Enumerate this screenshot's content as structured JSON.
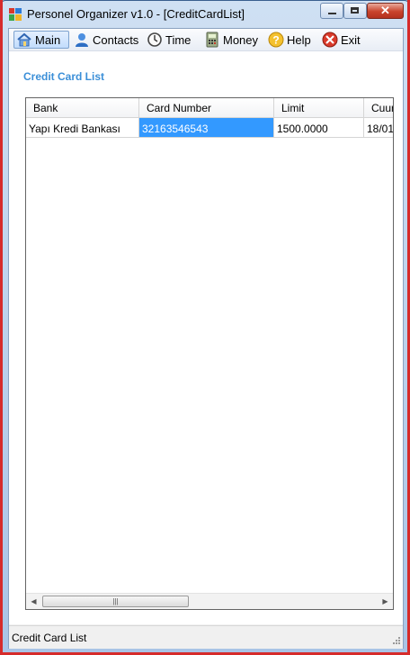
{
  "window": {
    "title": "Personel Organizer v1.0 - [CreditCardList]"
  },
  "menu": {
    "items": [
      {
        "label": "Main",
        "icon": "home-icon"
      },
      {
        "label": "Contacts",
        "icon": "person-icon"
      },
      {
        "label": "Time",
        "icon": "clock-icon"
      },
      {
        "label": "Money",
        "icon": "calculator-icon"
      },
      {
        "label": "Help",
        "icon": "help-icon"
      },
      {
        "label": "Exit",
        "icon": "exit-icon"
      }
    ],
    "active": "Main"
  },
  "page": {
    "heading": "Credit Card List"
  },
  "grid": {
    "columns": [
      "Bank",
      "Card Number",
      "Limit",
      "Cuur"
    ],
    "rows": [
      [
        "Yapı Kredi Bankası",
        "32163546543",
        "1500.0000",
        "18/01"
      ]
    ],
    "selected_cell": "Card Number"
  },
  "status": {
    "text": "Credit Card List"
  },
  "colors": {
    "heading": "#3b8fd8",
    "selection": "#3399ff",
    "frame": "#d62b2b"
  }
}
